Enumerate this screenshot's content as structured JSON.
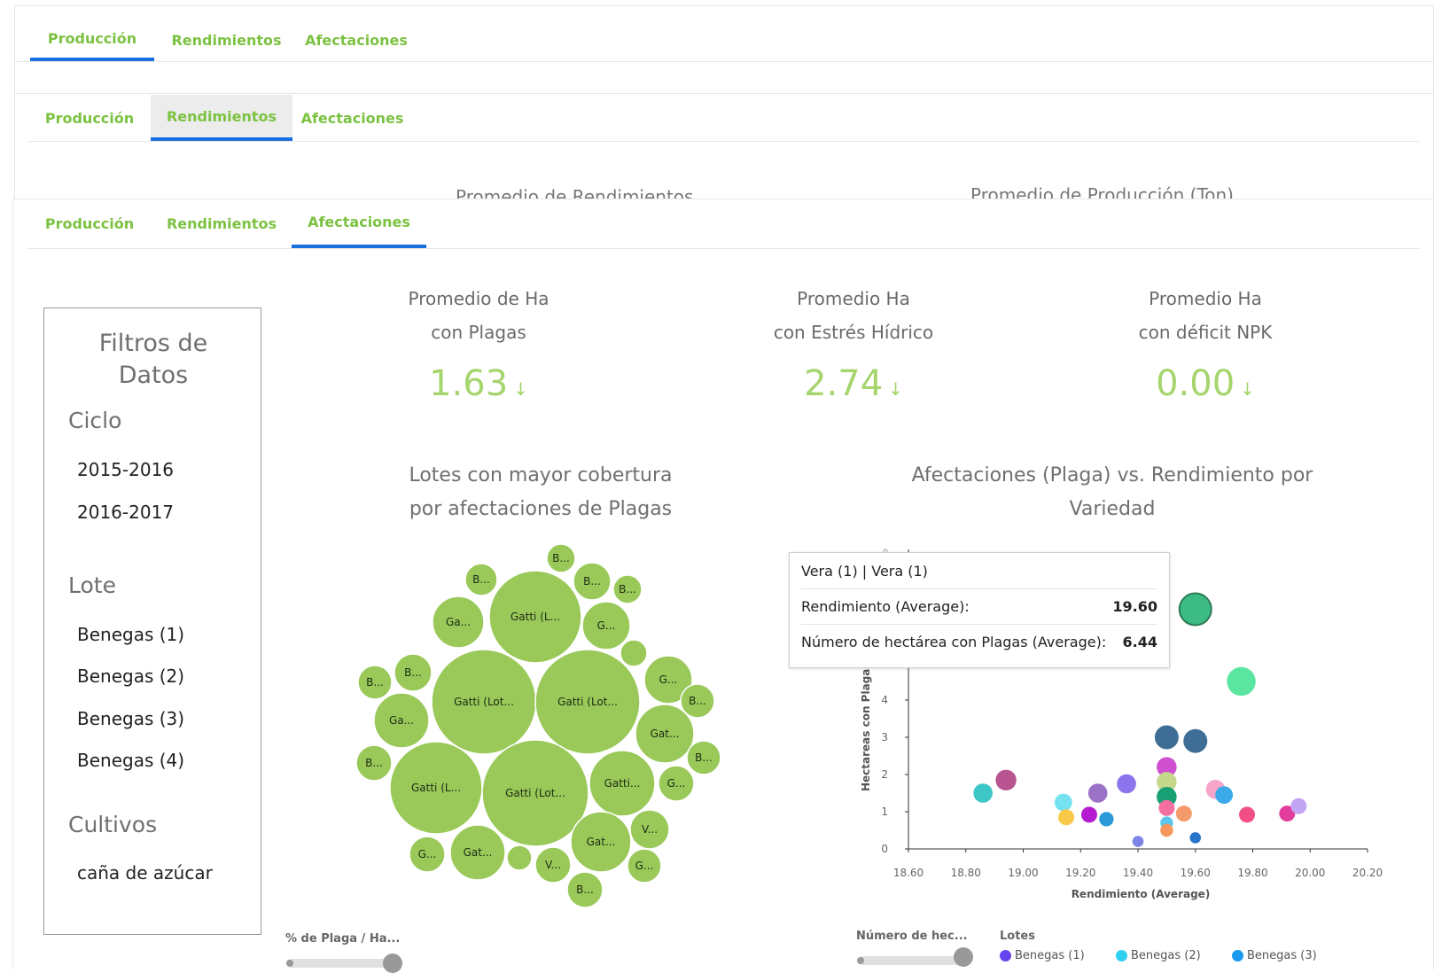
{
  "tabs": {
    "produccion": "Producción",
    "rendimientos": "Rendimientos",
    "afectaciones": "Afectaciones"
  },
  "peek_titles": {
    "left": "Promedio de Rendimientos",
    "right": "Promedio de Producción (Ton)"
  },
  "filters": {
    "title_line1": "Filtros de",
    "title_line2": "Datos",
    "ciclo_label": "Ciclo",
    "ciclos": [
      "2015-2016",
      "2016-2017"
    ],
    "lote_label": "Lote",
    "lotes": [
      "Benegas (1)",
      "Benegas (2)",
      "Benegas (3)",
      "Benegas (4)"
    ],
    "cultivos_label": "Cultivos",
    "cultivos": [
      "caña de azúcar"
    ]
  },
  "kpis": [
    {
      "label1": "Promedio de Ha",
      "label2": "con Plagas",
      "value": "1.63",
      "arrow": "↓"
    },
    {
      "label1": "Promedio Ha",
      "label2": "con Estrés Hídrico",
      "value": "2.74",
      "arrow": "↓"
    },
    {
      "label1": "Promedio Ha",
      "label2": "con déficit NPK",
      "value": "0.00",
      "arrow": "↓"
    }
  ],
  "bubble_chart": {
    "title1": "Lotes con mayor cobertura",
    "title2": "por afectaciones de Plagas",
    "bubbles": [
      {
        "label": "B...",
        "fill": "#9ac95a"
      },
      {
        "label": "Gatti (L...",
        "fill": "#9ac95a"
      },
      {
        "label": "B...",
        "fill": "#9ac95a"
      },
      {
        "label": "B...",
        "fill": "#9ac95a"
      },
      {
        "label": "B...",
        "fill": "#9ac95a"
      },
      {
        "label": "Ga...",
        "fill": "#9ac95a"
      },
      {
        "label": "G...",
        "fill": "#9ac95a"
      },
      {
        "label": "",
        "fill": "#9ac95a"
      },
      {
        "label": "B...",
        "fill": "#9ac95a"
      },
      {
        "label": "B...",
        "fill": "#9ac95a"
      },
      {
        "label": "Gatti (Lot...",
        "fill": "#9ac95a"
      },
      {
        "label": "Gatti (Lot...",
        "fill": "#9ac95a"
      },
      {
        "label": "G...",
        "fill": "#9ac95a"
      },
      {
        "label": "B...",
        "fill": "#9ac95a"
      },
      {
        "label": "Ga...",
        "fill": "#9ac95a"
      },
      {
        "label": "Gat...",
        "fill": "#9ac95a"
      },
      {
        "label": "B...",
        "fill": "#9ac95a"
      },
      {
        "label": "B...",
        "fill": "#9ac95a"
      },
      {
        "label": "Gatti (L...",
        "fill": "#9ac95a"
      },
      {
        "label": "Gatti (Lot...",
        "fill": "#9ac95a"
      },
      {
        "label": "Gatti...",
        "fill": "#9ac95a"
      },
      {
        "label": "G...",
        "fill": "#9ac95a"
      },
      {
        "label": "V...",
        "fill": "#9ac95a"
      },
      {
        "label": "G...",
        "fill": "#9ac95a"
      },
      {
        "label": "Gat...",
        "fill": "#9ac95a"
      },
      {
        "label": "",
        "fill": "#9ac95a"
      },
      {
        "label": "V...",
        "fill": "#9ac95a"
      },
      {
        "label": "Gat...",
        "fill": "#9ac95a"
      },
      {
        "label": "G...",
        "fill": "#9ac95a"
      },
      {
        "label": "B...",
        "fill": "#9ac95a"
      }
    ]
  },
  "scatter": {
    "title1": "Afectaciones (Plaga) vs. Rendimiento por",
    "title2": "Variedad"
  },
  "chart_data": {
    "type": "scatter",
    "title": "Afectaciones (Plaga) vs. Rendimiento por Variedad",
    "xlabel": "Rendimiento (Average)",
    "ylabel": "Hectareas con Plaga (",
    "xlim": [
      18.6,
      20.2
    ],
    "ylim": [
      0,
      8
    ],
    "xticks": [
      "18.60",
      "18.80",
      "19.00",
      "19.20",
      "19.40",
      "19.60",
      "19.80",
      "20.00",
      "20.20"
    ],
    "yticks": [
      "0",
      "1",
      "2",
      "3",
      "4"
    ],
    "points": [
      {
        "x": 19.6,
        "y": 6.44,
        "size": 4.0,
        "color": "#3dbb84",
        "stroke": "#2a7a55"
      },
      {
        "x": 19.76,
        "y": 4.5,
        "size": 3.6,
        "color": "#5ae5a0"
      },
      {
        "x": 19.5,
        "y": 3.0,
        "size": 3.0,
        "color": "#3e6e95"
      },
      {
        "x": 19.6,
        "y": 2.9,
        "size": 3.0,
        "color": "#3e6e95"
      },
      {
        "x": 19.5,
        "y": 2.2,
        "size": 2.5,
        "color": "#d04fd0"
      },
      {
        "x": 19.5,
        "y": 1.8,
        "size": 2.5,
        "color": "#c6d88c"
      },
      {
        "x": 19.5,
        "y": 1.4,
        "size": 2.5,
        "color": "#16a073"
      },
      {
        "x": 19.5,
        "y": 1.1,
        "size": 2.0,
        "color": "#f56ea0"
      },
      {
        "x": 19.5,
        "y": 0.7,
        "size": 1.6,
        "color": "#5bc6ee"
      },
      {
        "x": 19.5,
        "y": 0.5,
        "size": 1.6,
        "color": "#f5975a"
      },
      {
        "x": 18.94,
        "y": 1.85,
        "size": 2.6,
        "color": "#b8548f"
      },
      {
        "x": 18.86,
        "y": 1.5,
        "size": 2.4,
        "color": "#3cc6c6"
      },
      {
        "x": 19.14,
        "y": 1.25,
        "size": 2.2,
        "color": "#75e2f2"
      },
      {
        "x": 19.15,
        "y": 0.85,
        "size": 2.0,
        "color": "#f9c94a"
      },
      {
        "x": 19.23,
        "y": 0.92,
        "size": 2.0,
        "color": "#b41bd0"
      },
      {
        "x": 19.26,
        "y": 1.5,
        "size": 2.4,
        "color": "#9a73c7"
      },
      {
        "x": 19.29,
        "y": 0.8,
        "size": 1.8,
        "color": "#2a9bd8"
      },
      {
        "x": 19.36,
        "y": 1.75,
        "size": 2.4,
        "color": "#8d74ee"
      },
      {
        "x": 19.4,
        "y": 0.2,
        "size": 1.4,
        "color": "#7d84e8"
      },
      {
        "x": 19.56,
        "y": 0.95,
        "size": 2.0,
        "color": "#f59a6a"
      },
      {
        "x": 19.6,
        "y": 0.3,
        "size": 1.4,
        "color": "#2a74c9"
      },
      {
        "x": 19.67,
        "y": 1.6,
        "size": 2.4,
        "color": "#f7a6c9"
      },
      {
        "x": 19.7,
        "y": 1.45,
        "size": 2.2,
        "color": "#3aa9e8"
      },
      {
        "x": 19.78,
        "y": 0.92,
        "size": 2.0,
        "color": "#f14e88"
      },
      {
        "x": 19.92,
        "y": 0.95,
        "size": 2.0,
        "color": "#e23c9c"
      },
      {
        "x": 19.96,
        "y": 1.15,
        "size": 2.0,
        "color": "#c3a4f2"
      }
    ]
  },
  "tooltip": {
    "title": "Vera (1) | Vera (1)",
    "row1_label": "Rendimiento (Average):",
    "row1_value": "19.60",
    "row2_label": "Número de hectárea con Plagas (Average):",
    "row2_value": "6.44"
  },
  "bottom": {
    "slider1_label": "% de Plaga / Ha...",
    "slider2_label": "Número de hec...",
    "legend_title": "Lotes",
    "legend": [
      {
        "label": "Benegas (1)",
        "color": "#6645ee"
      },
      {
        "label": "Benegas (2)",
        "color": "#2fd0ee"
      },
      {
        "label": "Benegas (3)",
        "color": "#1a9aef"
      }
    ]
  }
}
